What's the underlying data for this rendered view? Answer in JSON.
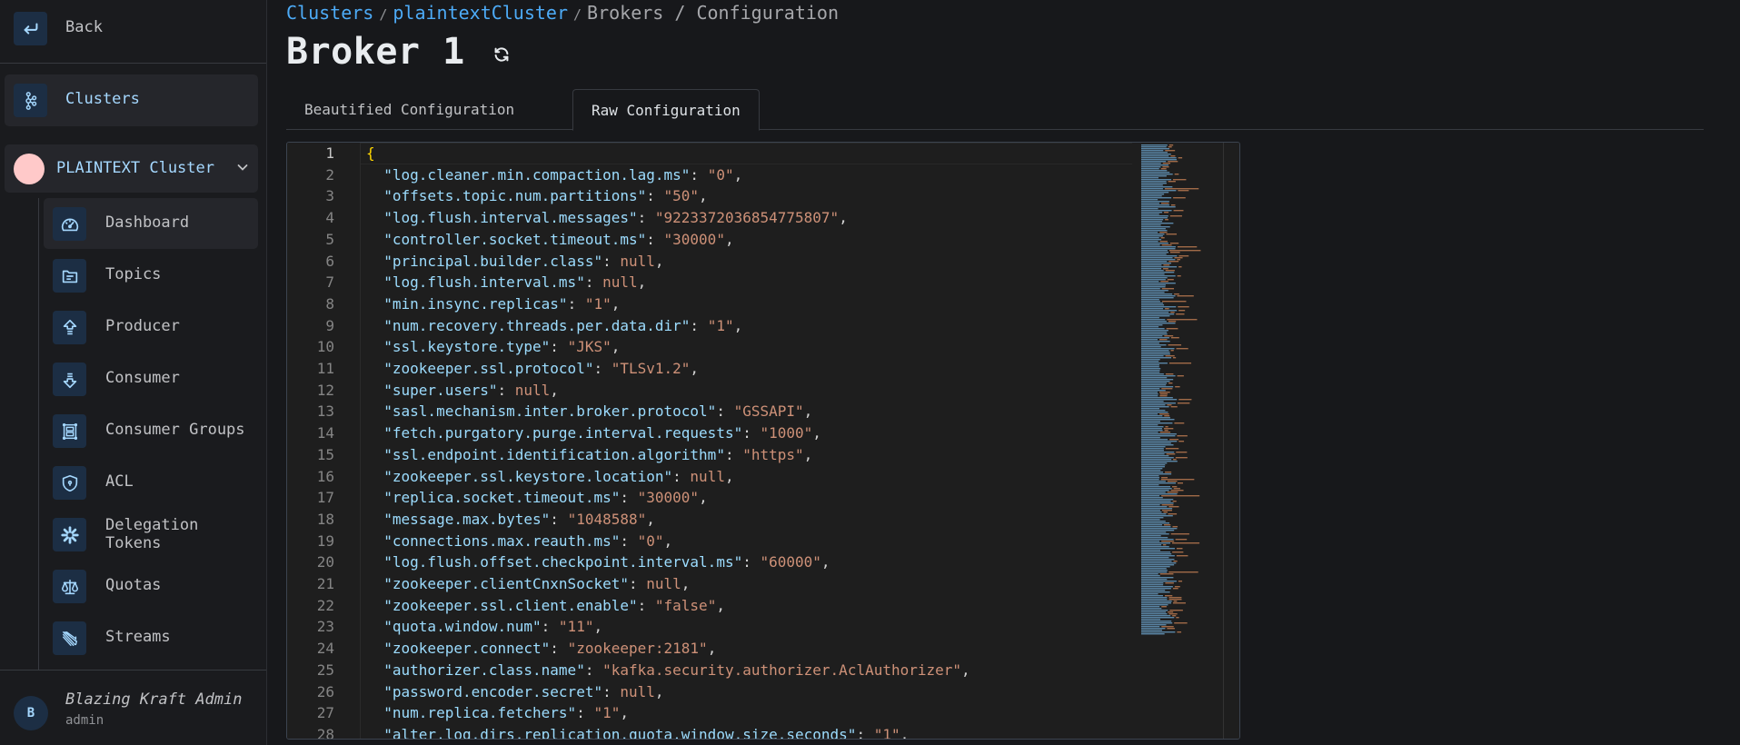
{
  "sidebar": {
    "back_label": "Back",
    "clusters_label": "Clusters",
    "cluster_name": "PLAINTEXT Cluster",
    "cluster_color": "#ffc9c9",
    "nav": [
      {
        "label": "Dashboard",
        "icon": "gauge-icon",
        "active": true
      },
      {
        "label": "Topics",
        "icon": "folder-icon"
      },
      {
        "label": "Producer",
        "icon": "arrow-up-icon"
      },
      {
        "label": "Consumer",
        "icon": "arrow-down-icon"
      },
      {
        "label": "Consumer Groups",
        "icon": "layout-rows-icon"
      },
      {
        "label": "ACL",
        "icon": "shield-lock-icon"
      },
      {
        "label": "Delegation Tokens",
        "icon": "asterisk-icon"
      },
      {
        "label": "Quotas",
        "icon": "scale-icon"
      },
      {
        "label": "Streams",
        "icon": "streams-icon"
      }
    ],
    "user": {
      "initial": "B",
      "name": "Blazing Kraft Admin",
      "role": "admin"
    }
  },
  "header": {
    "breadcrumb": {
      "clusters": "Clusters",
      "cluster": "plaintextCluster",
      "sep": "/",
      "rest": "Brokers / Configuration"
    },
    "title": "Broker 1"
  },
  "tabs": [
    {
      "label": "Beautified Configuration",
      "active": false
    },
    {
      "label": "Raw Configuration",
      "active": true
    }
  ],
  "editor": {
    "open_brace": "{",
    "entries": [
      {
        "key": "log.cleaner.min.compaction.lag.ms",
        "value": "\"0\""
      },
      {
        "key": "offsets.topic.num.partitions",
        "value": "\"50\""
      },
      {
        "key": "log.flush.interval.messages",
        "value": "\"9223372036854775807\""
      },
      {
        "key": "controller.socket.timeout.ms",
        "value": "\"30000\""
      },
      {
        "key": "principal.builder.class",
        "value": "null"
      },
      {
        "key": "log.flush.interval.ms",
        "value": "null"
      },
      {
        "key": "min.insync.replicas",
        "value": "\"1\""
      },
      {
        "key": "num.recovery.threads.per.data.dir",
        "value": "\"1\""
      },
      {
        "key": "ssl.keystore.type",
        "value": "\"JKS\""
      },
      {
        "key": "zookeeper.ssl.protocol",
        "value": "\"TLSv1.2\""
      },
      {
        "key": "super.users",
        "value": "null"
      },
      {
        "key": "sasl.mechanism.inter.broker.protocol",
        "value": "\"GSSAPI\""
      },
      {
        "key": "fetch.purgatory.purge.interval.requests",
        "value": "\"1000\""
      },
      {
        "key": "ssl.endpoint.identification.algorithm",
        "value": "\"https\""
      },
      {
        "key": "zookeeper.ssl.keystore.location",
        "value": "null"
      },
      {
        "key": "replica.socket.timeout.ms",
        "value": "\"30000\""
      },
      {
        "key": "message.max.bytes",
        "value": "\"1048588\""
      },
      {
        "key": "connections.max.reauth.ms",
        "value": "\"0\""
      },
      {
        "key": "log.flush.offset.checkpoint.interval.ms",
        "value": "\"60000\""
      },
      {
        "key": "zookeeper.clientCnxnSocket",
        "value": "null"
      },
      {
        "key": "zookeeper.ssl.client.enable",
        "value": "\"false\""
      },
      {
        "key": "quota.window.num",
        "value": "\"11\""
      },
      {
        "key": "zookeeper.connect",
        "value": "\"zookeeper:2181\""
      },
      {
        "key": "authorizer.class.name",
        "value": "\"kafka.security.authorizer.AclAuthorizer\""
      },
      {
        "key": "password.encoder.secret",
        "value": "null"
      },
      {
        "key": "num.replica.fetchers",
        "value": "\"1\""
      },
      {
        "key": "alter.log.dirs.replication.quota.window.size.seconds",
        "value": "\"1\""
      }
    ]
  }
}
